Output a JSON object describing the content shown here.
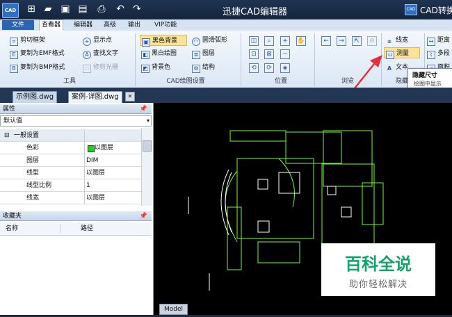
{
  "titlebar": {
    "app_logo": "CAD",
    "title": "迅捷CAD编辑器",
    "brand_logo": "CAD",
    "brand_text": "CAD转换"
  },
  "quick_access": [
    "new-icon",
    "open-icon",
    "save-icon",
    "save-as-icon",
    "print-icon",
    "undo-icon",
    "redo-icon"
  ],
  "menu_tabs": [
    "文件",
    "查看器",
    "编辑器",
    "高级",
    "输出",
    "VIP功能"
  ],
  "ribbon": {
    "tools": {
      "label": "工具",
      "items": [
        "剪切框架",
        "复制为EMF格式",
        "复制为BMP格式",
        "显示点",
        "查找文字",
        "修剪光栅"
      ]
    },
    "cad_settings": {
      "label": "CAD绘图设置",
      "items": [
        "黑色背景",
        "圆滑弧形",
        "黑白绘图",
        "图层",
        "背景色",
        "结构"
      ]
    },
    "position": {
      "label": "位置"
    },
    "browse": {
      "label": "浏览"
    },
    "hide": {
      "label": "隐藏",
      "items": [
        "线宽",
        "测量",
        "文本"
      ]
    },
    "extra": {
      "items": [
        "距离",
        "多段",
        "面积"
      ]
    }
  },
  "tooltip": {
    "title": "隐藏尺寸",
    "desc": "绘图中显示"
  },
  "doc_tabs": [
    "示例图.dwg",
    "案例-详图.dwg"
  ],
  "properties": {
    "title": "属性",
    "combo_value": "默认值",
    "category": "一般设置",
    "rows": [
      {
        "k": "色彩",
        "v": "以图层"
      },
      {
        "k": "图层",
        "v": "DIM"
      },
      {
        "k": "线型",
        "v": "以图层"
      },
      {
        "k": "线型比例",
        "v": "1"
      },
      {
        "k": "线宽",
        "v": "以图层"
      }
    ],
    "pin": "📌"
  },
  "favorites": {
    "title": "收藏夹",
    "col_name": "名称",
    "col_path": "路径"
  },
  "canvas": {
    "model_tab": "Model"
  },
  "watermark": {
    "main": "百科全说",
    "sub": "助你轻松解决"
  },
  "colors": {
    "accent": "#2b63b5",
    "cad_line": "#6cff2a",
    "cad_white": "#ffffff",
    "arrow": "#e0303c"
  }
}
